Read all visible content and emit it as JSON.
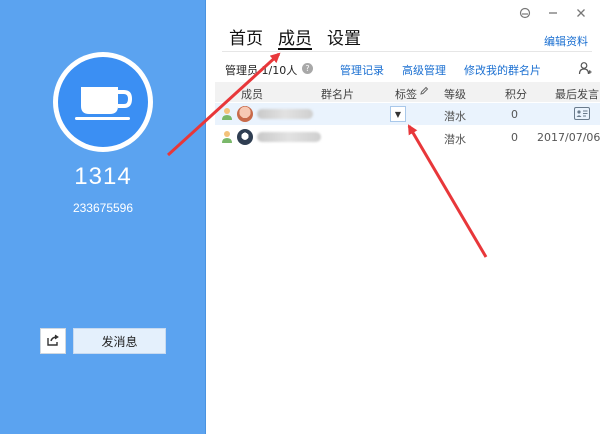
{
  "left": {
    "group_name": "1314",
    "group_id": "233675596",
    "share_icon": "share-icon",
    "send_label": "发消息",
    "avatar_icon": "coffee-cup-icon"
  },
  "tabs": [
    {
      "label": "首页"
    },
    {
      "label": "成员"
    },
    {
      "label": "设置"
    }
  ],
  "edit_label": "编辑资料",
  "window_icons": [
    "skin-icon",
    "minimize-icon",
    "close-icon"
  ],
  "toolbar": {
    "admin_label": "管理员",
    "count_label": "1/10人",
    "help_icon": "help-icon",
    "links": [
      "管理记录",
      "高级管理",
      "修改我的群名片"
    ],
    "user_icon": "add-member-icon"
  },
  "table": {
    "headers": [
      "成员",
      "群名片",
      "标签",
      "等级",
      "积分",
      "最后发言"
    ],
    "rows": [
      {
        "name": "",
        "card": "",
        "tag": "",
        "level": "潜水",
        "points": "0",
        "last": ""
      },
      {
        "name": "",
        "card": "",
        "tag": "",
        "level": "潜水",
        "points": "0",
        "last": "2017/07/06"
      }
    ]
  },
  "colors": {
    "sidebar_bg": "#5ba3f0",
    "avatar_bg": "#3b8ff3",
    "link": "#1a6fd1",
    "arrow": "#e8373a"
  }
}
